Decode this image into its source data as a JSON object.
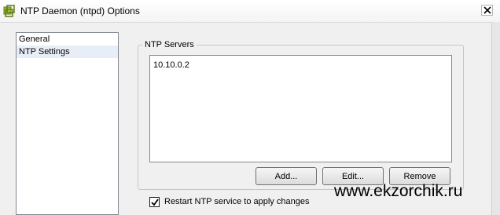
{
  "window": {
    "title": "NTP Daemon (ntpd) Options",
    "icon": "app-icon",
    "close_icon": "close-icon"
  },
  "nav": {
    "items": [
      {
        "label": "General",
        "selected": false
      },
      {
        "label": "NTP Settings",
        "selected": true
      }
    ]
  },
  "ntp_servers": {
    "group_label": "NTP Servers",
    "servers": [
      "10.10.0.2"
    ],
    "buttons": {
      "add": "Add...",
      "edit": "Edit...",
      "remove": "Remove"
    }
  },
  "restart_option": {
    "label": "Restart NTP service to apply changes",
    "checked": true
  },
  "watermark": "www.ekzorchik.ru",
  "colors": {
    "list_border": "#828790",
    "selected_item": "#e8eef8",
    "window_bg": "#f0f0f0"
  }
}
